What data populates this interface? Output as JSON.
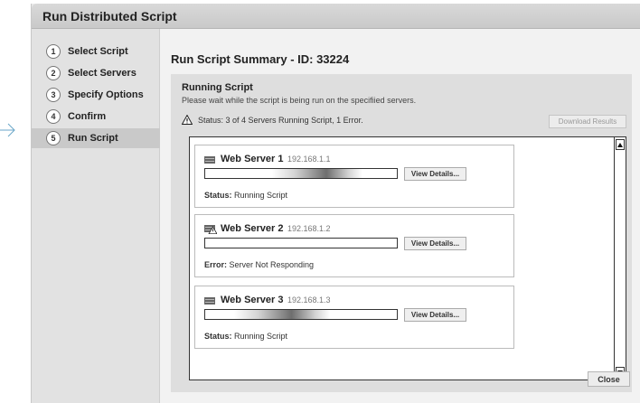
{
  "window": {
    "title": "Run Distributed Script"
  },
  "steps": [
    {
      "num": "1",
      "label": "Select Script"
    },
    {
      "num": "2",
      "label": "Select Servers"
    },
    {
      "num": "3",
      "label": "Specify Options"
    },
    {
      "num": "4",
      "label": "Confirm"
    },
    {
      "num": "5",
      "label": "Run Script",
      "active": true
    }
  ],
  "main": {
    "title": "Run Script Summary - ID: 33224",
    "heading": "Running Script",
    "subtitle": "Please wait while the script is being run on the specifiied servers.",
    "status": "Status: 3 of 4 Servers Running Script, 1 Error.",
    "download_label": "Download Results",
    "close_label": "Close"
  },
  "servers": [
    {
      "name": "Web Server 1",
      "ip": "192.168.1.1",
      "details_label": "View Details...",
      "status_key": "Status:",
      "status_text": " Running Script",
      "icon": "server-icon",
      "progress_start": 0.35,
      "progress_end": 0.82
    },
    {
      "name": "Web Server 2",
      "ip": "192.168.1.2",
      "details_label": "View Details...",
      "status_key": "Error:",
      "status_text": " Server Not Responding",
      "icon": "server-warning-icon",
      "progress_start": 0,
      "progress_end": 0
    },
    {
      "name": "Web Server 3",
      "ip": "192.168.1.3",
      "details_label": "View Details...",
      "status_key": "Status:",
      "status_text": " Running Script",
      "icon": "server-icon",
      "progress_start": 0.15,
      "progress_end": 0.65
    }
  ],
  "icons": {
    "arrow": "arrow-right-icon",
    "warning": "warning-icon",
    "scroll_up": "scroll-up-icon",
    "scroll_down": "scroll-down-icon"
  }
}
